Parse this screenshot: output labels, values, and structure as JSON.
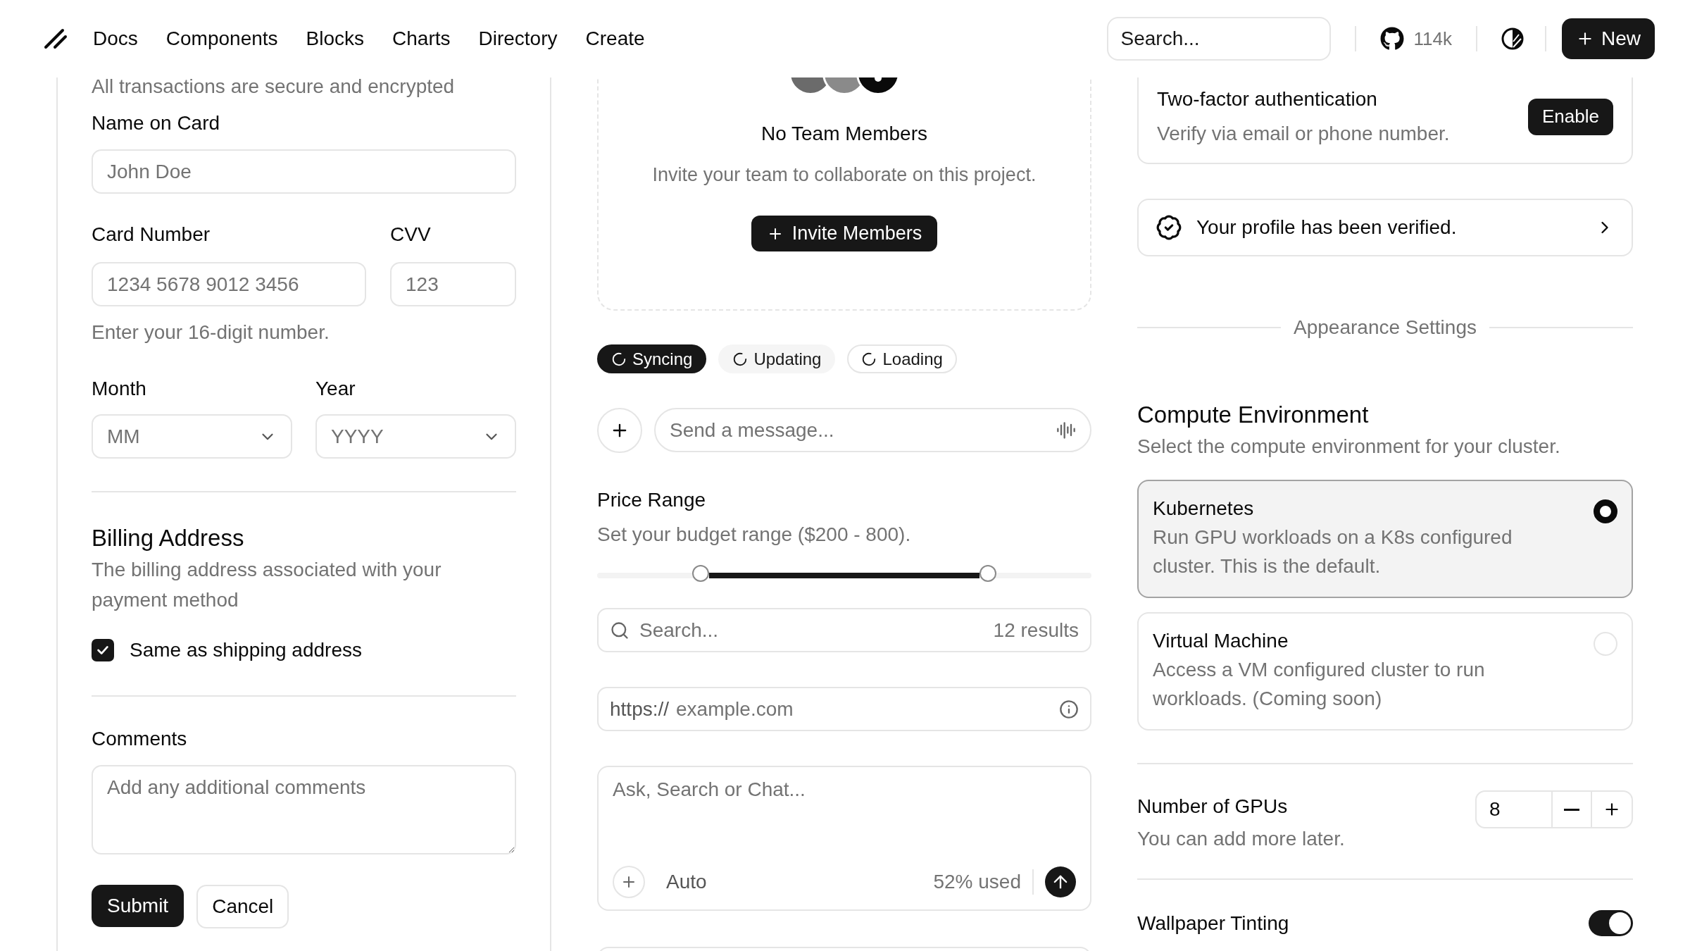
{
  "header": {
    "nav": [
      "Docs",
      "Components",
      "Blocks",
      "Charts",
      "Directory",
      "Create"
    ],
    "search": {
      "placeholder": "Search..."
    },
    "github_stars": "114k",
    "new_button": "New"
  },
  "payment": {
    "note": "All transactions are secure and encrypted",
    "name": {
      "label": "Name on Card",
      "placeholder": "John Doe"
    },
    "card_number": {
      "label": "Card Number",
      "placeholder": "1234 5678 9012 3456"
    },
    "cvv": {
      "label": "CVV",
      "placeholder": "123"
    },
    "card_help": "Enter your 16-digit number.",
    "month": {
      "label": "Month",
      "placeholder": "MM"
    },
    "year": {
      "label": "Year",
      "placeholder": "YYYY"
    },
    "billing": {
      "title": "Billing Address",
      "description": "The billing address associated with your payment method",
      "same_as_shipping": {
        "label": "Same as shipping address",
        "checked": true
      }
    },
    "comments": {
      "label": "Comments",
      "placeholder": "Add any additional comments"
    },
    "buttons": {
      "submit": "Submit",
      "cancel": "Cancel"
    }
  },
  "team": {
    "title": "No Team Members",
    "description": "Invite your team to collaborate on this project.",
    "invite_button": "Invite Members"
  },
  "badges": [
    {
      "label": "Syncing",
      "kind": "solid"
    },
    {
      "label": "Updating",
      "kind": "secondary"
    },
    {
      "label": "Loading",
      "kind": "outline"
    }
  ],
  "message": {
    "placeholder": "Send a message..."
  },
  "price_range": {
    "label": "Price Range",
    "description": "Set your budget range ($200 - 800).",
    "thumbs": [
      {
        "level": 0.21
      },
      {
        "level": 0.79
      }
    ]
  },
  "results_search": {
    "placeholder": "Search...",
    "count": "12 results"
  },
  "url_field": {
    "prefix": "https://",
    "placeholder": "example.com"
  },
  "chat": {
    "placeholder": "Ask, Search or Chat...",
    "mode": "Auto",
    "usage": "52% used"
  },
  "security": {
    "title": "Two-factor authentication",
    "description": "Verify via email or phone number.",
    "button": "Enable"
  },
  "verified": {
    "text": "Your profile has been verified."
  },
  "appearance_divider": "Appearance Settings",
  "compute": {
    "title": "Compute Environment",
    "description": "Select the compute environment for your cluster.",
    "options": [
      {
        "title": "Kubernetes",
        "description": "Run GPU workloads on a K8s configured cluster. This is the default.",
        "selected": true
      },
      {
        "title": "Virtual Machine",
        "description": "Access a VM configured cluster to run workloads. (Coming soon)",
        "selected": false
      }
    ]
  },
  "gpus": {
    "label": "Number of GPUs",
    "description": "You can add more later.",
    "value": "8"
  },
  "wallpaper": {
    "label": "Wallpaper Tinting",
    "on": true
  }
}
